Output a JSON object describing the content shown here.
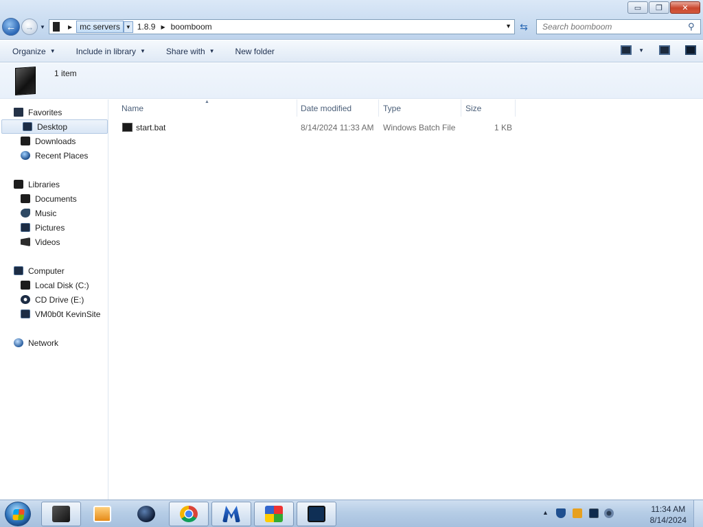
{
  "window": {
    "minimize_glyph": "▭",
    "maximize_glyph": "❐",
    "close_glyph": "✕"
  },
  "address": {
    "crumbs": [
      "mc servers",
      "1.8.9",
      "boomboom"
    ],
    "separator_glyph": "▶",
    "dropdown_glyph": "▼"
  },
  "search": {
    "placeholder": "Search boomboom"
  },
  "toolbar": {
    "organize": "Organize",
    "include_in_library": "Include in library",
    "share_with": "Share with",
    "new_folder": "New folder"
  },
  "details": {
    "item_count": "1 item"
  },
  "nav": {
    "favorites": "Favorites",
    "desktop": "Desktop",
    "downloads": "Downloads",
    "recent_places": "Recent Places",
    "libraries": "Libraries",
    "documents": "Documents",
    "music": "Music",
    "pictures": "Pictures",
    "videos": "Videos",
    "computer": "Computer",
    "local_disk": "Local Disk (C:)",
    "cd_drive": "CD Drive (E:)",
    "network_share": "VM0b0t KevinSite",
    "network": "Network"
  },
  "columns": {
    "name": "Name",
    "date_modified": "Date modified",
    "type": "Type",
    "size": "Size"
  },
  "files": [
    {
      "name": "start.bat",
      "date_modified": "8/14/2024 11:33 AM",
      "type": "Windows Batch File",
      "size": "1 KB"
    }
  ],
  "clock": {
    "time": "11:34 AM",
    "date": "8/14/2024"
  },
  "colors": {
    "accent": "#2c68b6",
    "selection": "#d9e6f5",
    "taskbar": "#b6cde6"
  }
}
